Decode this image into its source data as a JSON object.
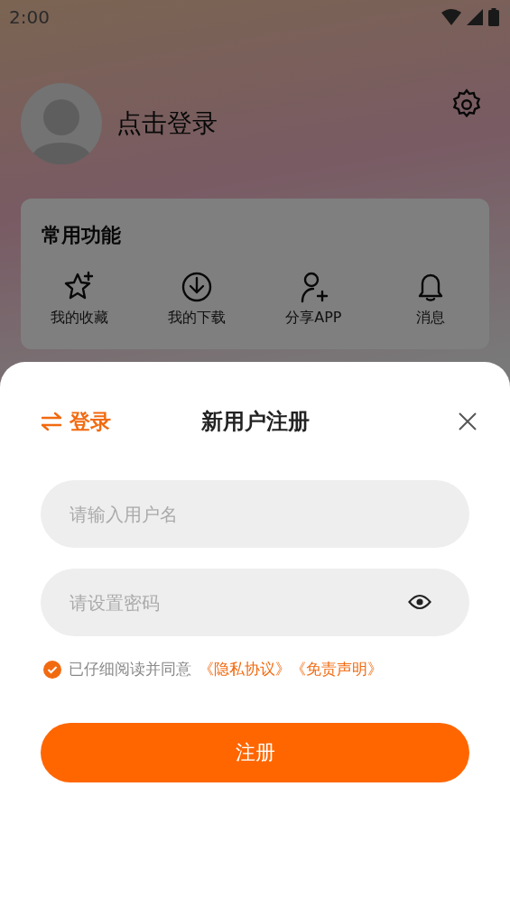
{
  "status_bar": {
    "time": "2:00"
  },
  "profile": {
    "name": "点击登录"
  },
  "common_functions": {
    "title": "常用功能",
    "items": [
      {
        "kind": "favorites",
        "label": "我的收藏"
      },
      {
        "kind": "downloads",
        "label": "我的下载"
      },
      {
        "kind": "share",
        "label": "分享APP"
      },
      {
        "kind": "messages",
        "label": "消息"
      }
    ]
  },
  "register_sheet": {
    "switch_link": "登录",
    "title": "新用户注册",
    "fields": [
      {
        "kind": "text",
        "placeholder": "请输入用户名"
      },
      {
        "kind": "password",
        "placeholder": "请设置密码"
      }
    ],
    "agreement": {
      "checked": true,
      "text": "已仔细阅读并同意",
      "links": [
        "《隐私协议》",
        "《免责声明》"
      ]
    },
    "submit": "注册"
  }
}
